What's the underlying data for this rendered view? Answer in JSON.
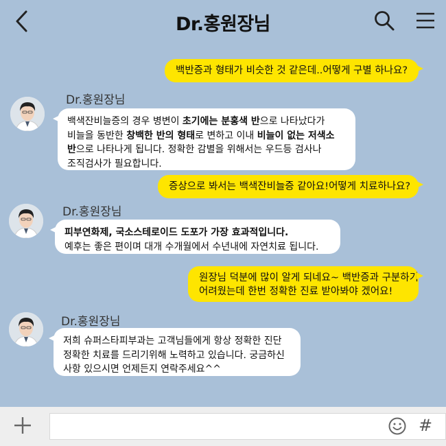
{
  "header": {
    "title": "Dr.홍원장님"
  },
  "messages": [
    {
      "type": "sent",
      "text": "백반증과 형태가 비슷한 것 같은데..어떻게 구별 하나요?"
    },
    {
      "type": "recv",
      "sender": "Dr.홍원장님",
      "lines": [
        [
          {
            "t": "백색잔비늘증의 경우 병변이 "
          },
          {
            "t": "초기에는 분홍색 반",
            "b": true
          },
          {
            "t": "으로 나타났다가"
          }
        ],
        [
          {
            "t": "비늘을 동반한 "
          },
          {
            "t": "창백한 반의 형태",
            "b": true
          },
          {
            "t": "로 변하고 이내 "
          },
          {
            "t": "비늘이 없는 저색소",
            "b": true
          }
        ],
        [
          {
            "t": "반",
            "b": true
          },
          {
            "t": "으로 나타나게 됩니다. 정확한 감별을 위해서는 우드등 검사나"
          }
        ],
        [
          {
            "t": "조직검사가 필요합니다."
          }
        ]
      ]
    },
    {
      "type": "sent",
      "text": "증상으로 봐서는 백색잔비늘증 같아요!어떻게 치료하나요?"
    },
    {
      "type": "recv",
      "sender": "Dr.홍원장님",
      "lines": [
        [
          {
            "t": "피부연화제, 국소스테로이드 도포가 가장 효과적입니다.",
            "b": true
          }
        ],
        [
          {
            "t": "예후는 좋은 편이며 대개 수개월에서 수년내에 자연치료 됩니다."
          }
        ]
      ]
    },
    {
      "type": "sent",
      "lines": [
        "원장님 덕분에 많이 알게 되네요~ 백반증과 구분하기",
        "어려웠는데 한번 정확한 진료 받아봐야 겠어요!"
      ]
    },
    {
      "type": "recv",
      "sender": "Dr.홍원장님",
      "lines": [
        [
          {
            "t": "저희 슈퍼스타피부과는 고객님들에게 항상 정확한 진단"
          }
        ],
        [
          {
            "t": "정확한 치료를 드리기위해 노력하고 있습니다. 궁금하신"
          }
        ],
        [
          {
            "t": "사항 있으시면 언제든지 연락주세요^^"
          }
        ]
      ]
    }
  ],
  "input": {
    "placeholder": ""
  },
  "icons": {
    "back": "chevron-left-icon",
    "search": "search-icon",
    "menu": "hamburger-menu-icon",
    "plus": "plus-icon",
    "emoji": "smiley-icon",
    "hash": "hash-icon"
  },
  "hash_symbol": "#",
  "colors": {
    "background": "#a9c0d8",
    "sent_bubble": "#fee500",
    "recv_bubble": "#ffffff"
  }
}
